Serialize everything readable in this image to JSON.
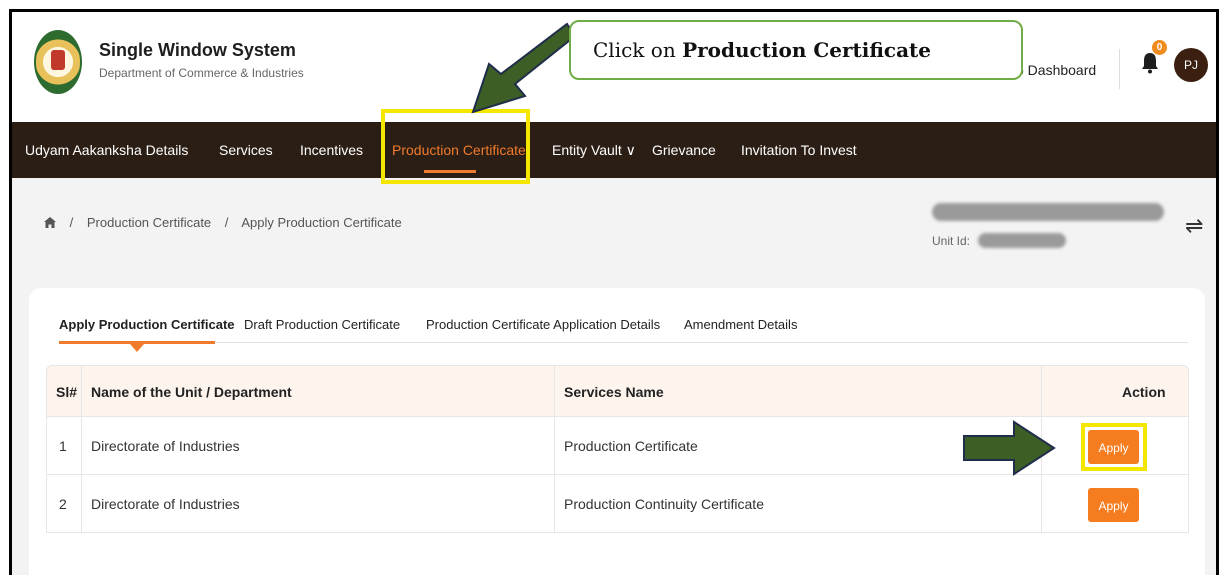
{
  "header": {
    "title": "Single Window System",
    "subtitle": "Department of Commerce & Industries",
    "dashboard_link": "o Dashboard",
    "notification_count": "0",
    "avatar_initials": "PJ"
  },
  "nav": {
    "items": [
      "Udyam Aakanksha Details",
      "Services",
      "Incentives",
      "Production Certificate",
      "Entity Vault ∨",
      "Grievance",
      "Invitation To Invest"
    ],
    "active": "Production Certificate"
  },
  "breadcrumb": {
    "items": [
      "Production Certificate",
      "Apply Production Certificate"
    ]
  },
  "unit": {
    "label": "Unit Id:"
  },
  "tabs": [
    "Apply Production Certificate",
    "Draft Production Certificate",
    "Production Certificate Application Details",
    "Amendment Details"
  ],
  "table": {
    "headers": [
      "Sl#",
      "Name of the Unit / Department",
      "Services Name",
      "Action"
    ],
    "rows": [
      {
        "sl": "1",
        "name": "Directorate of Industries",
        "service": "Production Certificate",
        "action": "Apply"
      },
      {
        "sl": "2",
        "name": "Directorate of Industries",
        "service": "Production Continuity Certificate",
        "action": "Apply"
      }
    ]
  },
  "callout": {
    "prefix": "Click on ",
    "bold": "Production Certificate"
  },
  "colors": {
    "accent": "#f17b2c",
    "navbar": "#2b1e14",
    "highlight": "#f5e600",
    "arrow": "#3d5f26"
  }
}
